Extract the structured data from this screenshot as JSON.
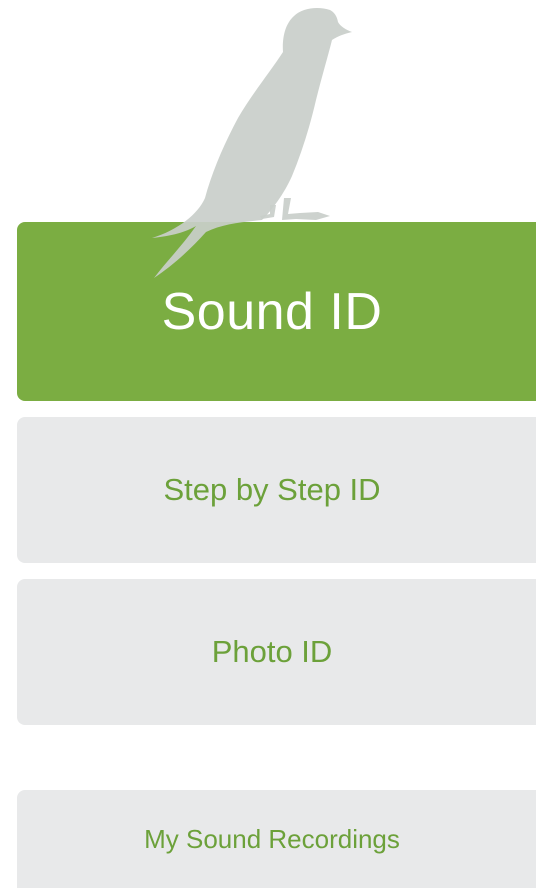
{
  "menu": {
    "sound_id_label": "Sound ID",
    "step_by_step_label": "Step by Step ID",
    "photo_id_label": "Photo ID",
    "recordings_label": "My Sound Recordings"
  },
  "colors": {
    "primary_green": "#7bad42",
    "text_green": "#6ca13a",
    "button_gray": "#e8e9ea",
    "bird_silhouette": "#c9ceca"
  },
  "icons": {
    "header_art": "bird-silhouette-icon"
  }
}
